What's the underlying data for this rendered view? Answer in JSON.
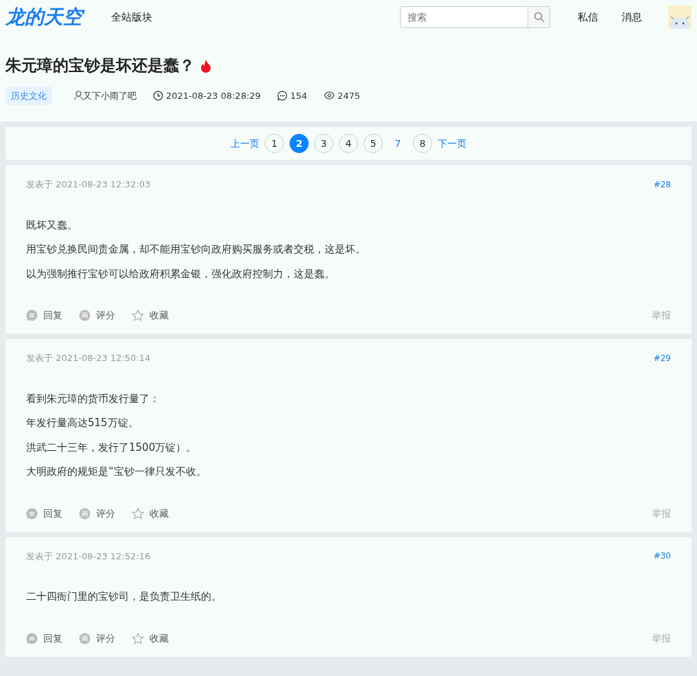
{
  "header": {
    "logo": "龙的天空",
    "nav": "全站版块",
    "search": {
      "placeholder": "搜索"
    },
    "links": [
      "私信",
      "消息"
    ]
  },
  "thread": {
    "title": "朱元璋的宝钞是坏还是蠢？",
    "hot": true,
    "category": "历史文化",
    "author": "又下小雨了吧",
    "time": "2021-08-23 08:28:29",
    "replies": "154",
    "views": "2475"
  },
  "pagination": {
    "prev": "上一页",
    "next": "下一页",
    "pages": [
      {
        "label": "1",
        "selected": false,
        "outlined": true
      },
      {
        "label": "2",
        "selected": true,
        "outlined": true
      },
      {
        "label": "3",
        "selected": false,
        "outlined": true
      },
      {
        "label": "4",
        "selected": false,
        "outlined": true
      },
      {
        "label": "5",
        "selected": false,
        "outlined": true
      },
      {
        "label": "7",
        "selected": false,
        "outlined": false
      },
      {
        "label": "8",
        "selected": false,
        "outlined": true
      }
    ]
  },
  "posts": [
    {
      "posted": "发表于 2021-08-23 12:32:03",
      "floor": "#28",
      "lines": [
        "既坏又蠢。",
        "用宝钞兑换民间贵金属，却不能用宝钞向政府购买服务或者交税，这是坏。",
        "以为强制推行宝钞可以给政府积累金银，强化政府控制力，这是蠢。"
      ],
      "actions": [
        "回复",
        "评分",
        "收藏"
      ],
      "report": "举报"
    },
    {
      "posted": "发表于 2021-08-23 12:50:14",
      "floor": "#29",
      "lines": [
        "看到朱元璋的货币发行量了：",
        "年发行量高达515万锭。",
        "洪武二十三年，发行了1500万锭）。",
        "大明政府的规矩是“宝钞一律只发不收。"
      ],
      "actions": [
        "回复",
        "评分",
        "收藏"
      ],
      "report": "举报"
    },
    {
      "posted": "发表于 2021-08-23 12:52:16",
      "floor": "#30",
      "lines": [
        "二十四衙门里的宝钞司，是负责卫生纸的。"
      ],
      "actions": [
        "回复",
        "评分",
        "收藏"
      ],
      "report": "举报"
    }
  ]
}
